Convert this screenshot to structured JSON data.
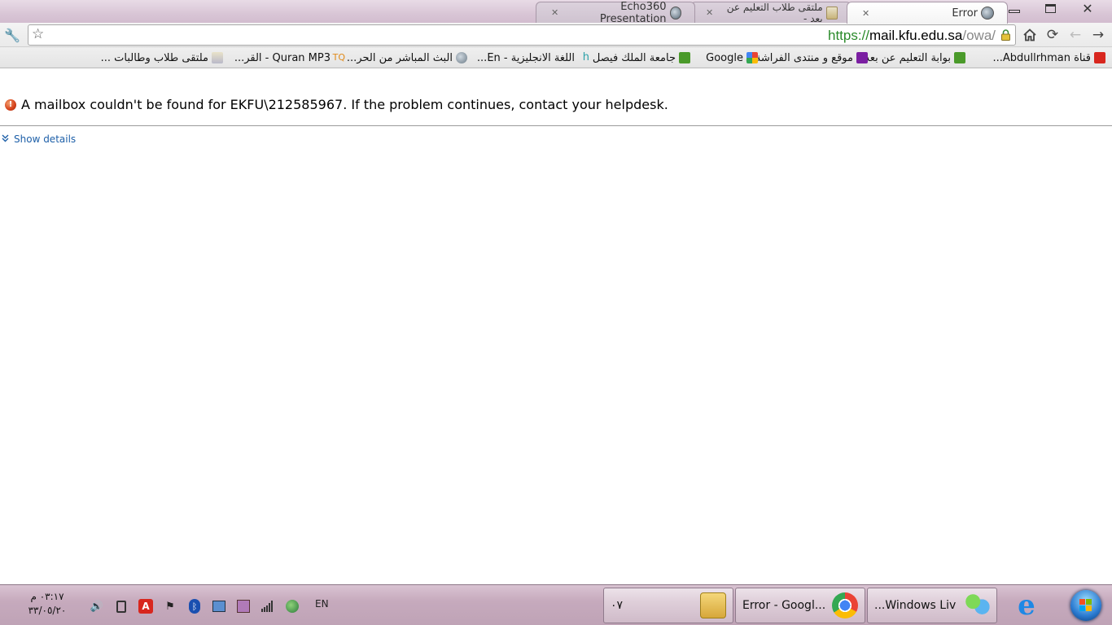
{
  "browser": {
    "tabs": [
      {
        "title": "Error",
        "active": true
      },
      {
        "title": "ملتقى طلاب التعليم عن بعد - ",
        "active": false
      },
      {
        "title": "Echo360 Presentation",
        "active": false
      }
    ],
    "url": {
      "scheme": "https://",
      "host": "mail.kfu.edu.sa",
      "path": "/owa/"
    },
    "bookmarks": [
      "قناة Abdullrhman...",
      "بوابة التعليم عن بعد",
      "موقع و منتدى الفراشة...",
      "Google",
      "جامعة الملك فيصل",
      "اللغة الانجليزية - En...",
      "البث المباشر من الحر...",
      "Quran MP3 - القر...",
      "ملتقى طلاب وطالبات ..."
    ]
  },
  "page": {
    "error_message": "A mailbox couldn't be found for EKFU\\212585967. If the problem continues, contact your helpdesk.",
    "show_details_label": "Show details"
  },
  "taskbar": {
    "clock_time": "٠٣:١٧ م",
    "clock_date": "٣٣/٠٥/٢٠",
    "language": "EN",
    "buttons": [
      {
        "label": "٠٧"
      },
      {
        "label": "Error - Googl..."
      },
      {
        "label": "...Windows Liv"
      }
    ]
  },
  "colors": {
    "link": "#1d5fa8",
    "secure_scheme": "#2a8a2a",
    "error_icon": "#d4401a"
  }
}
